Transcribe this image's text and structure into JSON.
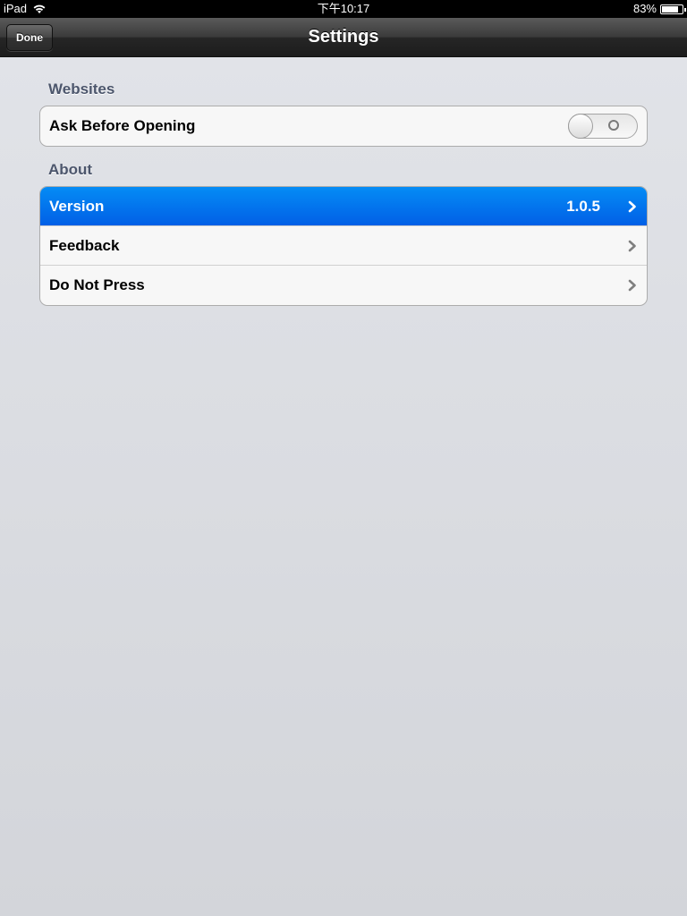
{
  "status_bar": {
    "device": "iPad",
    "time": "下午10:17",
    "battery": "83%",
    "battery_level": 0.83,
    "icons": [
      "wifi-icon",
      "battery-icon"
    ]
  },
  "nav_bar": {
    "title": "Settings",
    "done_label": "Done"
  },
  "sections": {
    "websites": {
      "header": "Websites",
      "ask_before_opening": {
        "label": "Ask Before Opening",
        "toggle_on": false
      }
    },
    "about": {
      "header": "About",
      "version": {
        "label": "Version",
        "value": "1.0.5",
        "selected": true
      },
      "feedback": {
        "label": "Feedback"
      },
      "do_not_press": {
        "label": "Do Not Press"
      }
    }
  },
  "colors": {
    "selected_cell": "#0272ef",
    "section_header": "#4c566c",
    "nav_bar": "#2b2b2b",
    "background": "#d7d9de"
  }
}
